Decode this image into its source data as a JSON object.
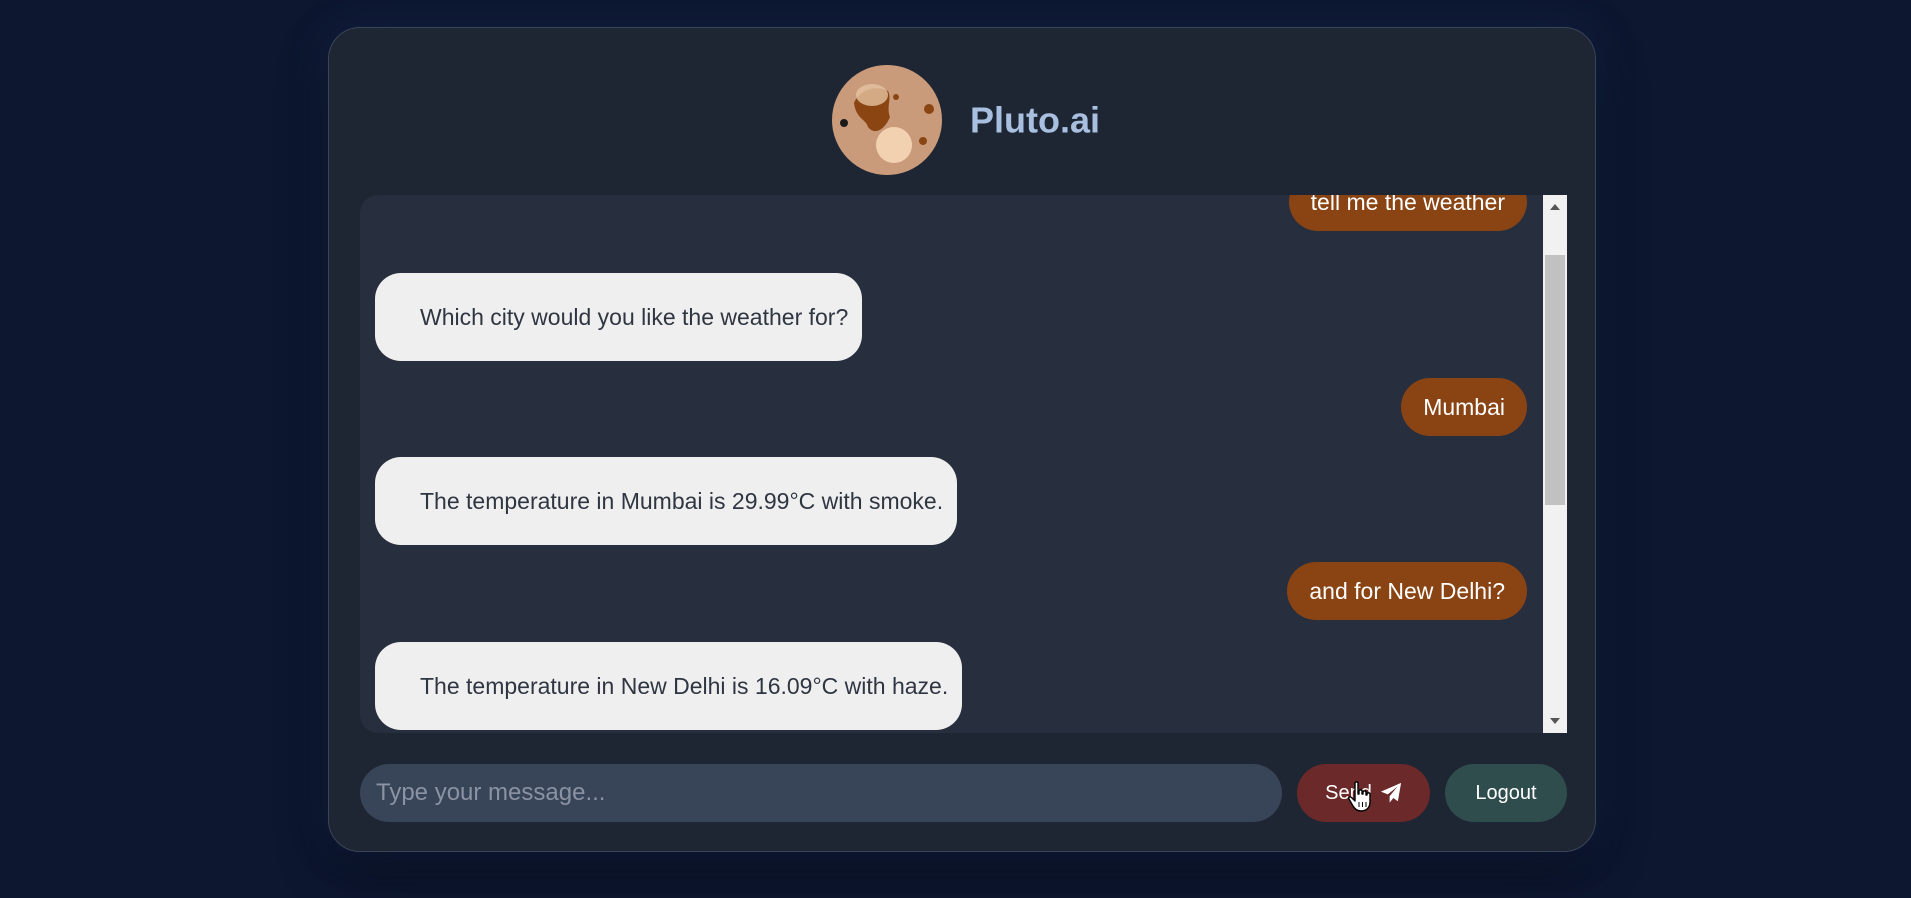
{
  "app": {
    "title": "Pluto.ai"
  },
  "messages": [
    {
      "sender": "user",
      "text": "tell me the weather"
    },
    {
      "sender": "bot",
      "text": "Which city would you like the weather for?"
    },
    {
      "sender": "user",
      "text": "Mumbai"
    },
    {
      "sender": "bot",
      "text": "The temperature in Mumbai is 29.99°C with smoke."
    },
    {
      "sender": "user",
      "text": "and for New Delhi?"
    },
    {
      "sender": "bot",
      "text": "The temperature in New Delhi is 16.09°C with haze."
    },
    {
      "sender": "user",
      "text": ""
    }
  ],
  "composer": {
    "placeholder": "Type your message...",
    "value": "",
    "send_label": "Send",
    "logout_label": "Logout"
  },
  "icons": {
    "avatar": "pluto-planet-icon",
    "send": "paper-plane-icon",
    "cursor": "hand-pointer-cursor"
  },
  "colors": {
    "page_background": "#0d1730",
    "card_background": "#1e2533",
    "chat_background": "#272e3d",
    "title": "#a9bfdf",
    "bot_bubble": "#efefef",
    "user_bubble": "#8a4414",
    "input_background": "#384457",
    "send_button": "#6b2929",
    "logout_button": "#2e4d4c"
  }
}
